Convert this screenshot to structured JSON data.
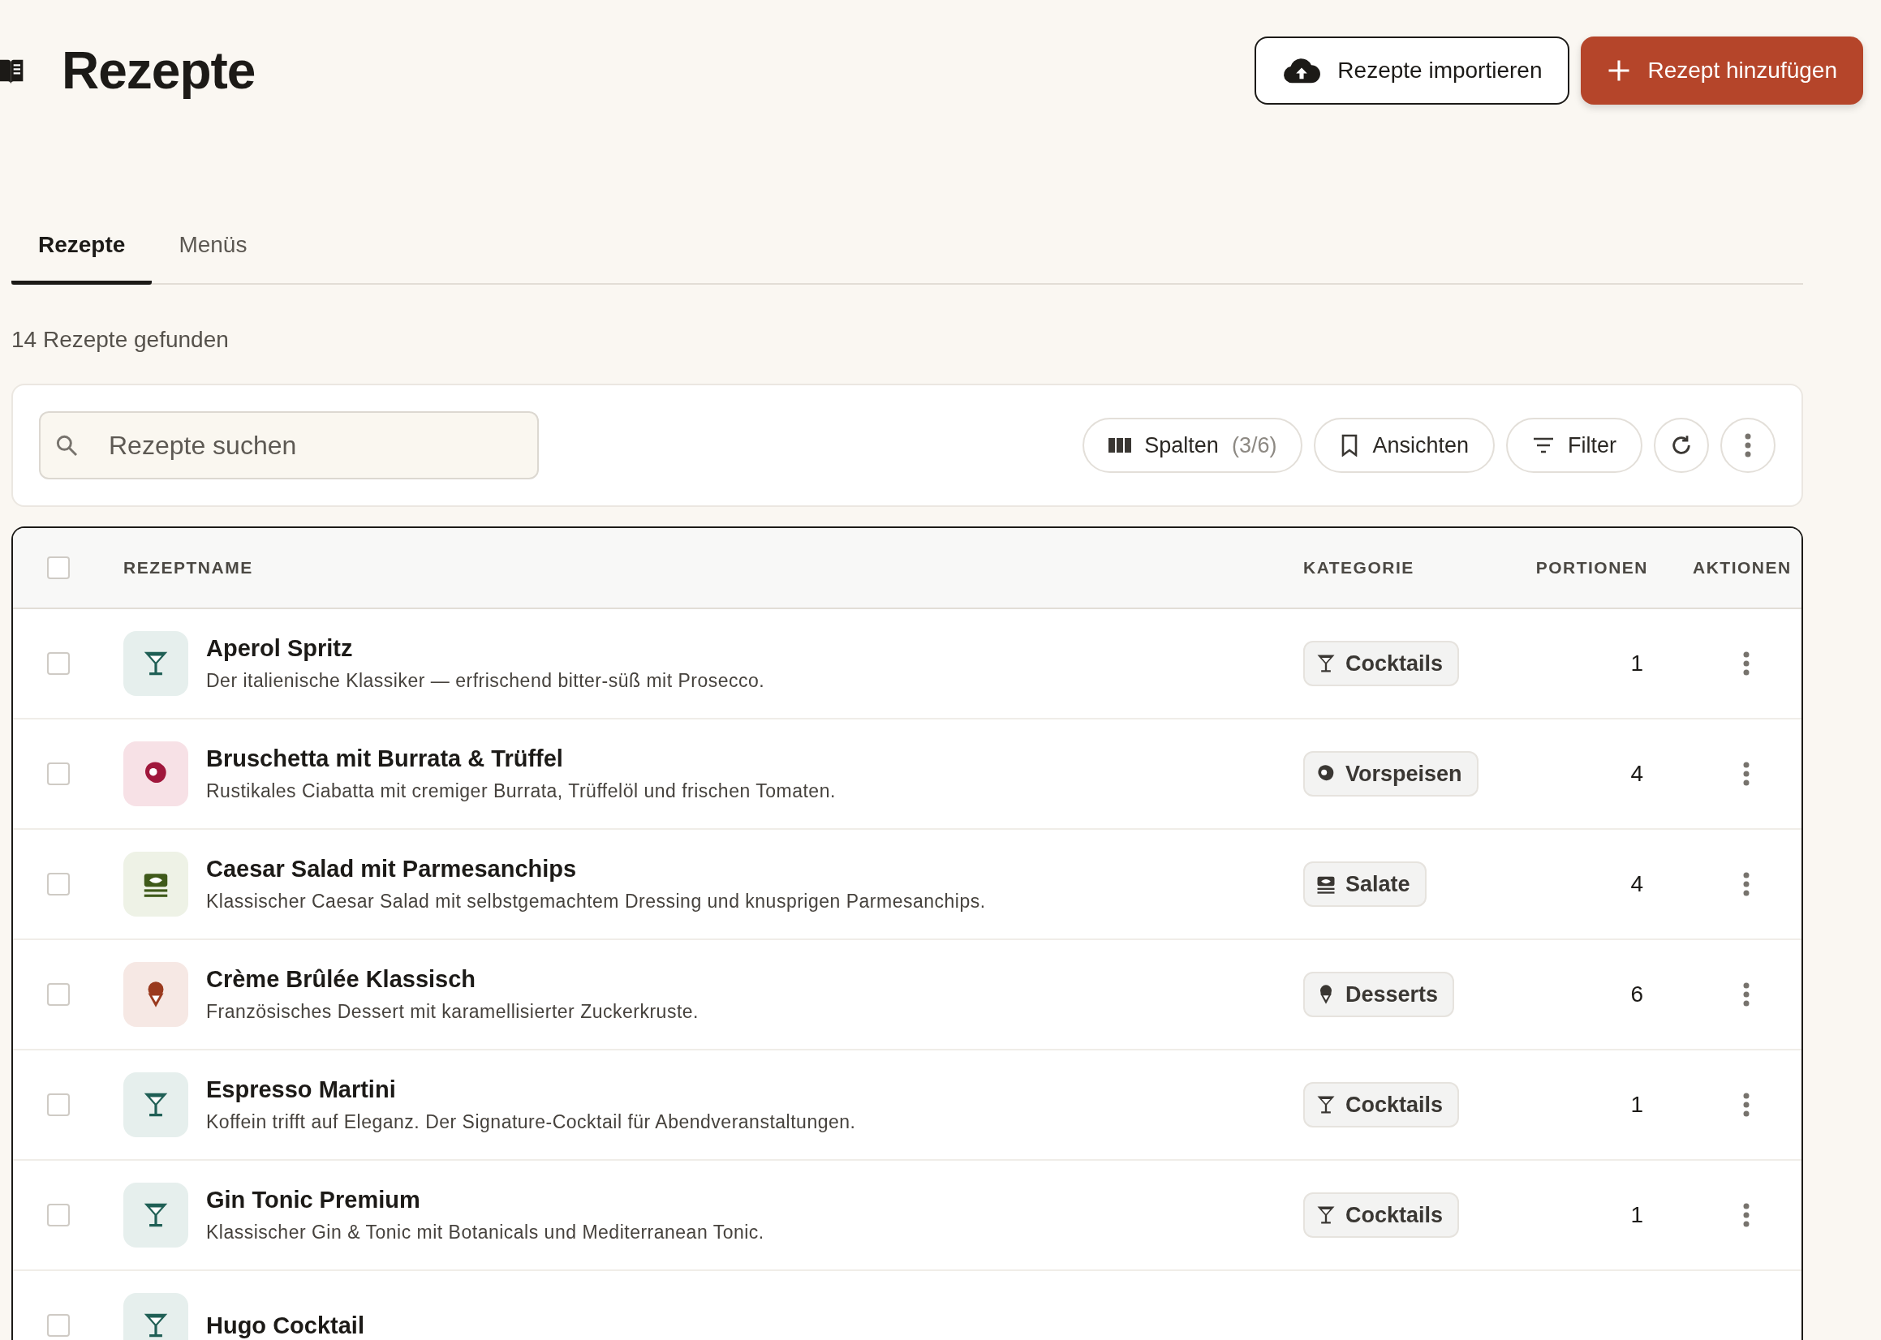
{
  "header": {
    "title": "Rezepte",
    "buttons": [
      {
        "kind": "secondary",
        "label": "Rezepte importieren"
      },
      {
        "kind": "primary",
        "label": "Rezept hinzufügen"
      }
    ]
  },
  "tabs": [
    {
      "label": "Rezepte",
      "selected": true
    },
    {
      "label": "Menüs",
      "selected": false
    }
  ],
  "result_count": "14 Rezepte gefunden",
  "toolbar": {
    "search": {
      "placeholder": "Rezepte suchen"
    },
    "columns_button": {
      "label": "Spalten",
      "count": "(3/6)"
    },
    "views_button": {
      "label": "Ansichten"
    },
    "filter_button": {
      "label": "Filter"
    }
  },
  "table": {
    "select_all": {
      "checked": false
    },
    "columns": [
      "REZEPTNAME",
      "KATEGORIE",
      "PORTIONEN",
      "AKTIONEN"
    ],
    "rows": [
      {
        "kind": "cocktail",
        "name": "Aperol Spritz",
        "description": "Der italienische Klassiker — erfrischend bitter-süß mit Prosecco.",
        "category": "Cocktails",
        "portions": "1",
        "checked": false
      },
      {
        "kind": "starter",
        "name": "Bruschetta mit Burrata & Trüffel",
        "description": "Rustikales Ciabatta mit cremiger Burrata, Trüffelöl und frischen Tomaten.",
        "category": "Vorspeisen",
        "portions": "4",
        "checked": false
      },
      {
        "kind": "salad",
        "name": "Caesar Salad mit Parmesanchips",
        "description": "Klassischer Caesar Salad mit selbstgemachtem Dressing und knusprigen Parmesanchips.",
        "category": "Salate",
        "portions": "4",
        "checked": false
      },
      {
        "kind": "dessert",
        "name": "Crème Brûlée Klassisch",
        "description": "Französisches Dessert mit karamellisierter Zuckerkruste.",
        "category": "Desserts",
        "portions": "6",
        "checked": false
      },
      {
        "kind": "cocktail",
        "name": "Espresso Martini",
        "description": "Koffein trifft auf Eleganz. Der Signature-Cocktail für Abendveranstaltungen.",
        "category": "Cocktails",
        "portions": "1",
        "checked": false
      },
      {
        "kind": "cocktail",
        "name": "Gin Tonic Premium",
        "description": "Klassischer Gin & Tonic mit Botanicals und Mediterranean Tonic.",
        "category": "Cocktails",
        "portions": "1",
        "checked": false
      },
      {
        "kind": "cocktail",
        "name": "Hugo Cocktail",
        "checked": false
      }
    ]
  }
}
